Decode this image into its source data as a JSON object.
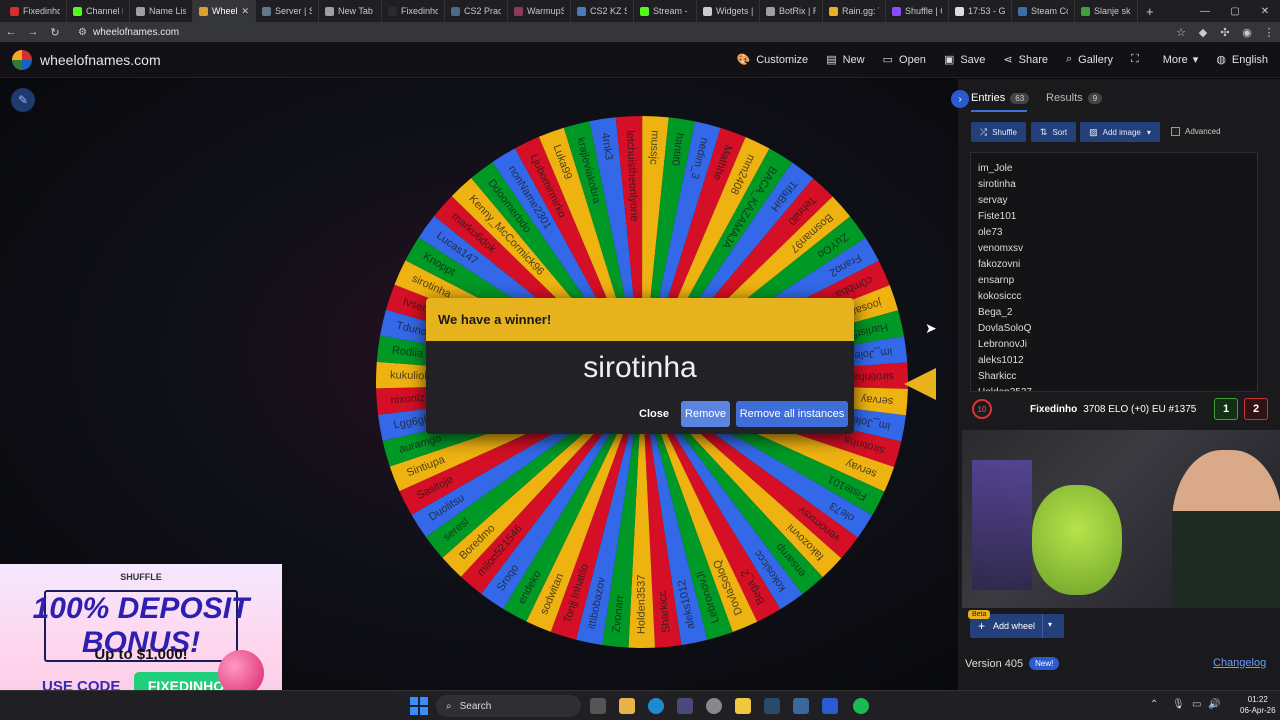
{
  "browser": {
    "tabs": [
      {
        "label": "Fixedinho",
        "color": "#d32f2f",
        "active": false
      },
      {
        "label": "Channel P",
        "color": "#53fc18",
        "active": false
      },
      {
        "label": "Name List",
        "color": "#9aa0a6",
        "active": false
      },
      {
        "label": "Wheel",
        "color": "#e0a030",
        "active": true
      },
      {
        "label": "Server | SC",
        "color": "#5f7a8a",
        "active": false
      },
      {
        "label": "New Tab",
        "color": "#9aa0a6",
        "active": false
      },
      {
        "label": "Fixedinho",
        "color": "#2b2b2b",
        "active": false
      },
      {
        "label": "CS2 Practi",
        "color": "#4a6a8a",
        "active": false
      },
      {
        "label": "WarmupSe",
        "color": "#8a3a5a",
        "active": false
      },
      {
        "label": "CS2 KZ Ser",
        "color": "#4a7abb",
        "active": false
      },
      {
        "label": "Stream - K",
        "color": "#53fc18",
        "active": false
      },
      {
        "label": "Widgets |",
        "color": "#cccccc",
        "active": false
      },
      {
        "label": "BotRix | Ra",
        "color": "#9aa0a6",
        "active": false
      },
      {
        "label": "Rain.gg: Tr",
        "color": "#e8b21c",
        "active": false
      },
      {
        "label": "Shuffle | C",
        "color": "#8a4cff",
        "active": false
      },
      {
        "label": "17:53 - Go",
        "color": "#dddddd",
        "active": false
      },
      {
        "label": "Steam Cor",
        "color": "#3b6ea5",
        "active": false
      },
      {
        "label": "Slanje skin",
        "color": "#3ca33c",
        "active": false
      }
    ],
    "new_tab": "+",
    "url": "wheelofnames.com"
  },
  "header": {
    "site_name": "wheelofnames.com",
    "menu": [
      {
        "label": "Customize",
        "icon": "palette-icon",
        "glyph": "🎨"
      },
      {
        "label": "New",
        "icon": "file-icon",
        "glyph": "▤"
      },
      {
        "label": "Open",
        "icon": "folder-icon",
        "glyph": "▭"
      },
      {
        "label": "Save",
        "icon": "save-icon",
        "glyph": "▣"
      },
      {
        "label": "Share",
        "icon": "share-icon",
        "glyph": "⋖"
      },
      {
        "label": "Gallery",
        "icon": "search-icon",
        "glyph": "⌕"
      },
      {
        "label": "",
        "icon": "fullscreen-icon",
        "glyph": "⛶"
      },
      {
        "label": "More",
        "icon": "chevron-down-icon",
        "glyph": ""
      },
      {
        "label": "English",
        "icon": "globe-icon",
        "glyph": "◍"
      }
    ]
  },
  "wheel": {
    "segment_colors": [
      "#3369e8",
      "#d50f25",
      "#eeb211",
      "#009925"
    ],
    "names": [
      "im_Jole",
      "sirotinha",
      "servay",
      "Fiste101",
      "ole73",
      "venomxsv",
      "fakozovni",
      "ensarnp",
      "kokosiccc",
      "Bega_2",
      "DovlaSoloQ",
      "LebronovJi",
      "aleks1012",
      "Sharkicc",
      "Holden3537",
      "Zvonarr",
      "ittibobazov",
      "Tonjj Inhatilo",
      "sodwitan",
      "endeko",
      "Sroqo",
      "milon521546",
      "Boredmo",
      "seresl",
      "Duolitsu",
      "Sasitoje",
      "Sintiupa",
      "auramgo",
      "Lgg6gl",
      "nixonlz",
      "kukuliok",
      "Rodiia",
      "Tdunon",
      "Ivseni777",
      "sirotinha",
      "Knoppt",
      "Lucas147",
      "marku6dok",
      "Kenny_McCormick96",
      "Ddoomerbdo",
      "nonName2301",
      "Ljubomirmirko",
      "Luka99",
      "krajleviakobra",
      "4rnk3",
      "letchuistheonlyone",
      "mussjc",
      "hantit0",
      "nedim_3",
      "Mathhe",
      "mm2408",
      "BACA_KAZAMAJA",
      "TifaBiH",
      "Tehnil0",
      "Bosman97",
      "ZuYOo",
      "Frano2",
      "c0mbba",
      "joosaa_0",
      "Harlist50",
      "im_Jole",
      "sirotinha",
      "servay"
    ]
  },
  "dialog": {
    "title": "We have a winner!",
    "winner": "sirotinha",
    "close": "Close",
    "remove": "Remove",
    "remove_all": "Remove all instances"
  },
  "panel": {
    "entries_label": "Entries",
    "entries_count": "63",
    "results_label": "Results",
    "results_count": "9",
    "shuffle": "Shuffle",
    "sort": "Sort",
    "add_image": "Add image",
    "advanced": "Advanced",
    "entries": [
      "im_Jole",
      "sirotinha",
      "servay",
      "Fiste101",
      "ole73",
      "venomxsv",
      "fakozovni",
      "ensarnp",
      "kokosiccc",
      "Bega_2",
      "DovlaSoloQ",
      "LebronovJi",
      "aleks1012",
      "Sharkicc",
      "Holden3537"
    ],
    "beta": "Beta",
    "add_wheel": "Add wheel",
    "version": "Version 405",
    "new_badge": "New!",
    "changelog": "Changelog"
  },
  "stream": {
    "badge": "10",
    "player": "Fixedinho",
    "elo": "3708 ELO (+0) EU #1375",
    "wins": "1",
    "losses": "2"
  },
  "ad": {
    "brand": "SHUFFLE",
    "headline": "100% DEPOSIT BONUS!",
    "subline": "Up to $1,000!",
    "code_label": "USE CODE",
    "code": "FIXEDINHO"
  },
  "taskbar": {
    "search": "Search",
    "time": "01:22",
    "date": "06-Apr-26"
  }
}
